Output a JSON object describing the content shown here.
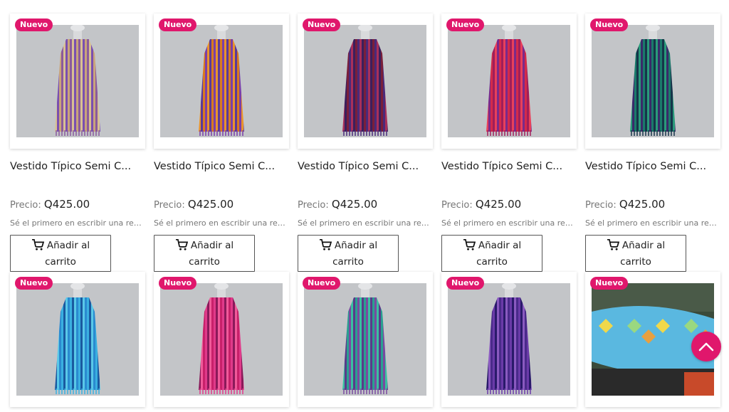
{
  "products": [
    {
      "badge": "Nuevo",
      "title": "Vestido Típico Semi C...",
      "price_label": "Precio:",
      "price": "Q425.00",
      "review": "Sé el primero en escribir una res...",
      "button": "Añadir al carrito",
      "colors": [
        "#c9a47a",
        "#8b5a9c",
        "#d8c092",
        "#7a4fb0"
      ]
    },
    {
      "badge": "Nuevo",
      "title": "Vestido Típico Semi C...",
      "price_label": "Precio:",
      "price": "Q425.00",
      "review": "Sé el primero en escribir una res...",
      "button": "Añadir al carrito",
      "colors": [
        "#d97a1e",
        "#7b3fa8",
        "#e9932b",
        "#5a3a9a"
      ]
    },
    {
      "badge": "Nuevo",
      "title": "Vestido Típico Semi C...",
      "price_label": "Precio:",
      "price": "Q425.00",
      "review": "Sé el primero en escribir una res...",
      "button": "Añadir al carrito",
      "colors": [
        "#7a1f3a",
        "#4a2a7a",
        "#a8305a",
        "#3b1f5c"
      ]
    },
    {
      "badge": "Nuevo",
      "title": "Vestido Típico Semi C...",
      "price_label": "Precio:",
      "price": "Q425.00",
      "review": "Sé el primero en escribir una res...",
      "button": "Añadir al carrito",
      "colors": [
        "#d42a4a",
        "#a01e5a",
        "#e8405a",
        "#7a2a8a"
      ]
    },
    {
      "badge": "Nuevo",
      "title": "Vestido Típico Semi C...",
      "price_label": "Precio:",
      "price": "Q425.00",
      "review": "Sé el primero en escribir una res...",
      "button": "Añadir al carrito",
      "colors": [
        "#1a7a6a",
        "#16354a",
        "#2a9a7a",
        "#3a2a6a"
      ]
    },
    {
      "badge": "Nuevo",
      "colors": [
        "#2a8ad0",
        "#3ab0e0",
        "#1a5aa0",
        "#5ac8e8"
      ]
    },
    {
      "badge": "Nuevo",
      "colors": [
        "#c8206a",
        "#e03a8a",
        "#8a1a5a",
        "#f05a9a"
      ]
    },
    {
      "badge": "Nuevo",
      "colors": [
        "#2aa090",
        "#7a4aa0",
        "#3ac0a0",
        "#5a3a8a"
      ]
    },
    {
      "badge": "Nuevo",
      "colors": [
        "#4a2a8a",
        "#6a3aa8",
        "#2a1a6a",
        "#8a5ac0"
      ]
    },
    {
      "badge": "Nuevo",
      "colors": [
        "#f0d84a",
        "#5ab8e0",
        "#9ad880",
        "#e8a040"
      ]
    }
  ],
  "scroll_top": {
    "icon": "chevron-up-icon",
    "color": "#e0176c"
  },
  "accent_color": "#e0176c"
}
